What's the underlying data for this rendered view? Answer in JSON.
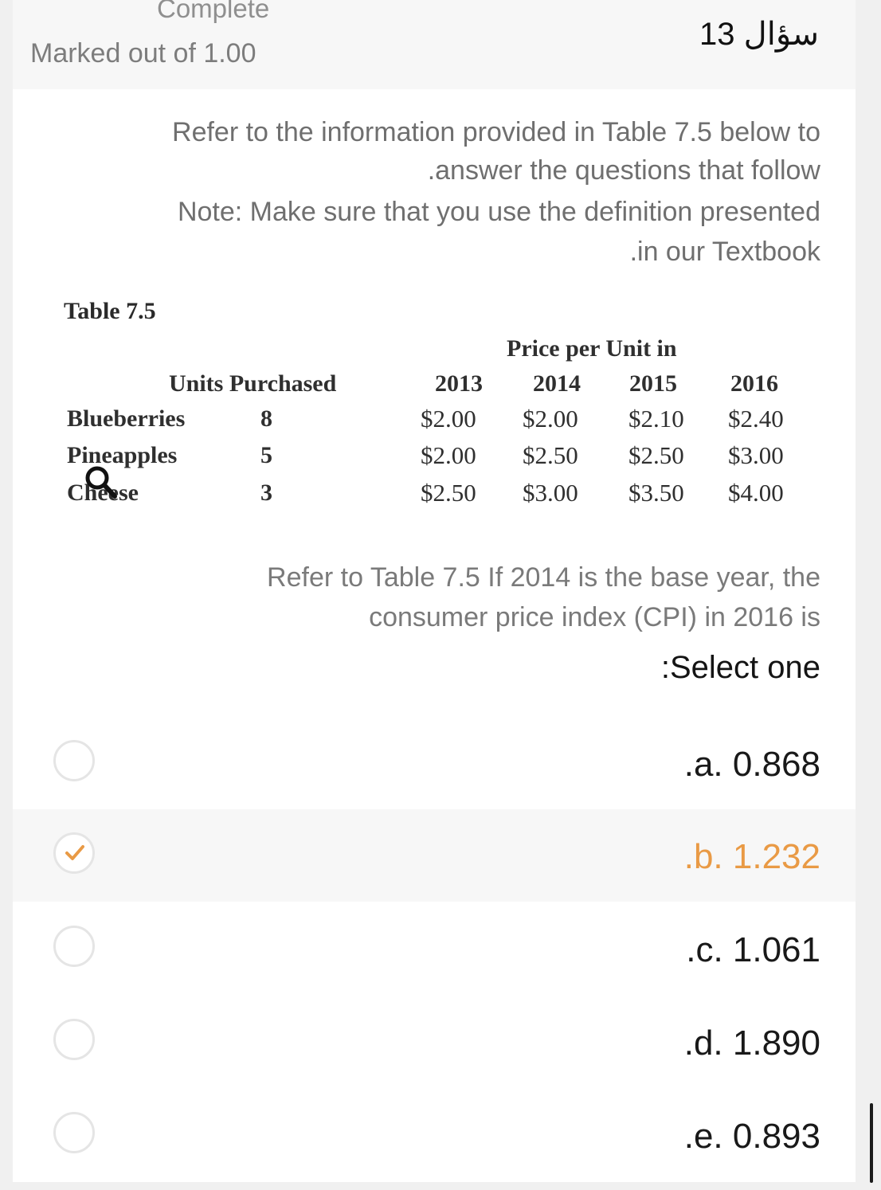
{
  "header": {
    "state": "Complete",
    "marked": "Marked out of 1.00",
    "question_number": "سؤال 13"
  },
  "intro": {
    "line1": "Refer to the information provided in Table 7.5 below to",
    "line2": ".answer the questions that follow",
    "line3": "Note: Make sure that you use the definition presented",
    "line4": ".in our Textbook"
  },
  "table": {
    "title": "Table 7.5",
    "price_header": "Price per Unit in",
    "units_header": "Units Purchased",
    "years": [
      "2013",
      "2014",
      "2015",
      "2016"
    ],
    "rows": [
      {
        "item": "Blueberries",
        "units": "8",
        "prices": [
          "$2.00",
          "$2.00",
          "$2.10",
          "$2.40"
        ]
      },
      {
        "item": "Pineapples",
        "units": "5",
        "prices": [
          "$2.00",
          "$2.50",
          "$2.50",
          "$3.00"
        ]
      },
      {
        "item": "Cheese",
        "units": "3",
        "prices": [
          "$2.50",
          "$3.00",
          "$3.50",
          "$4.00"
        ]
      }
    ]
  },
  "question": {
    "line1": "Refer to Table 7.5 If 2014 is the base year, the",
    "line2": "consumer price index (CPI) in 2016 is",
    "prompt": ":Select one"
  },
  "options": [
    {
      "label": ".a. 0.868",
      "selected": false
    },
    {
      "label": ".b. 1.232",
      "selected": true
    },
    {
      "label": ".c. 1.061",
      "selected": false
    },
    {
      "label": ".d. 1.890",
      "selected": false
    },
    {
      "label": ".e. 0.893",
      "selected": false
    }
  ],
  "colors": {
    "selected_accent": "#e99a45",
    "radio_border": "#e5e5e5"
  },
  "icons": {
    "magnifier": "magnifier-icon",
    "check": "checkmark-icon"
  }
}
